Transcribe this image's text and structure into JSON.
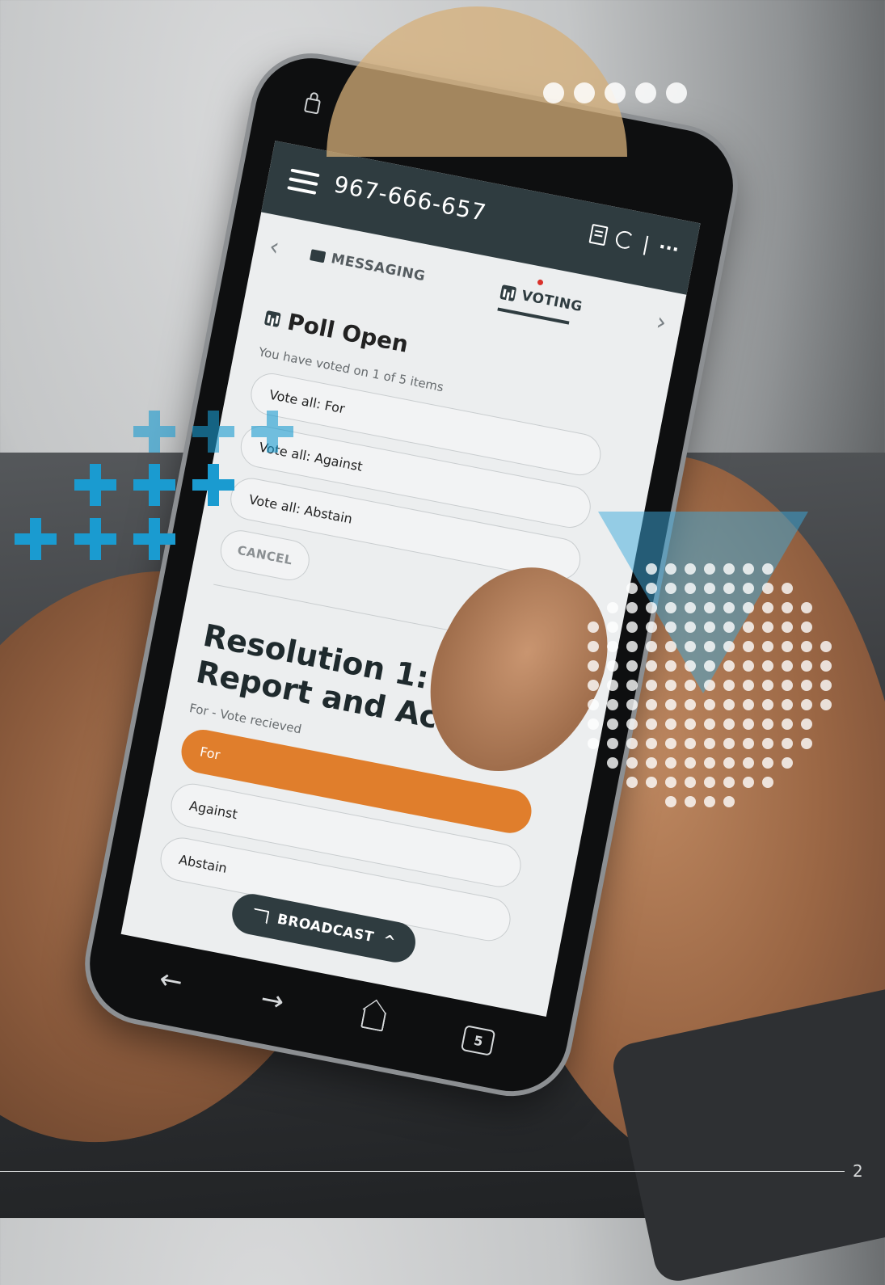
{
  "app": {
    "meeting_id": "967-666-657"
  },
  "tabs": {
    "messaging_label": "MESSAGING",
    "voting_label": "VOTING"
  },
  "poll": {
    "title": "Poll Open",
    "progress_text": "You have voted on 1 of 5 items",
    "vote_all_for": "Vote all: For",
    "vote_all_against": "Vote all: Against",
    "vote_all_abstain": "Vote all: Abstain",
    "cancel_label": "CANCEL"
  },
  "resolution": {
    "title": "Resolution 1: To re Report and Acc",
    "status": "For - Vote recieved",
    "options": [
      "For",
      "Against",
      "Abstain"
    ],
    "selected": "For"
  },
  "broadcast_label": "BROADCAST",
  "browser_nav": {
    "tab_count": "5"
  },
  "page_number": "2",
  "colors": {
    "appbar": "#2f3c40",
    "selected_option": "#e07e2c",
    "accent_blue": "#1a9bd0",
    "notification_dot": "#d9312b"
  },
  "icons": [
    "lock-icon",
    "menu-icon",
    "doc-icon",
    "refresh-icon",
    "more-icon",
    "chat-icon",
    "bars-icon",
    "cast-icon",
    "chevron-up-icon",
    "back-arrow-icon",
    "forward-arrow-icon",
    "home-icon",
    "tab-count-icon"
  ]
}
